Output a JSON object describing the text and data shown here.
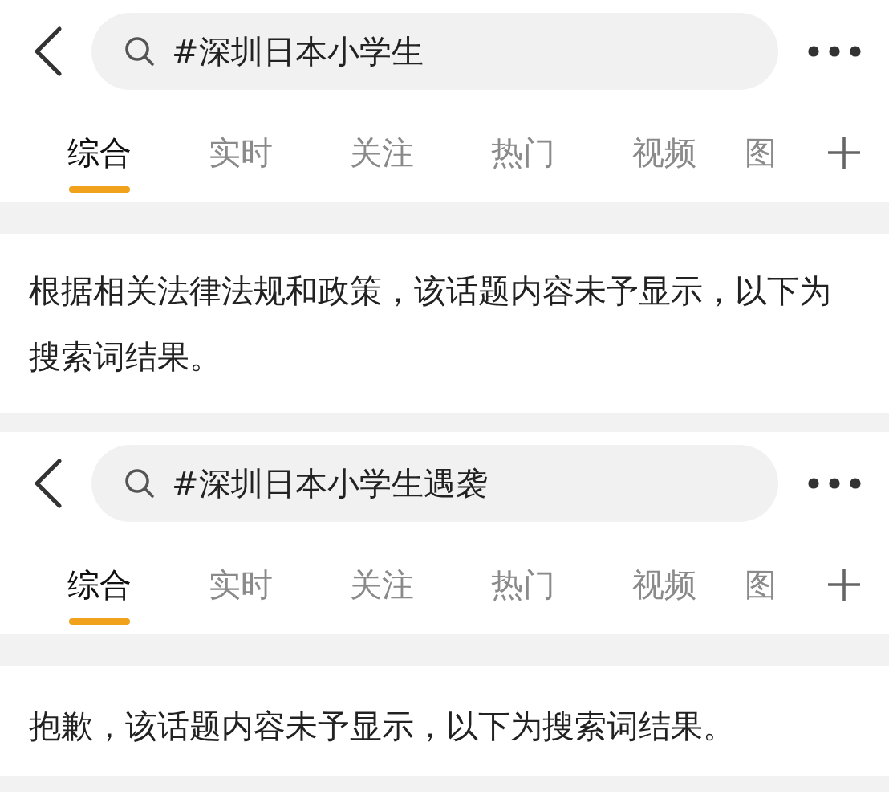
{
  "panels": [
    {
      "search": {
        "value": "#深圳日本小学生"
      },
      "tabs": [
        {
          "label": "综合",
          "selected": true
        },
        {
          "label": "实时",
          "selected": false
        },
        {
          "label": "关注",
          "selected": false
        },
        {
          "label": "热门",
          "selected": false
        },
        {
          "label": "视频",
          "selected": false
        },
        {
          "label": "图",
          "selected": false
        }
      ],
      "notice": "根据相关法律法规和政策，该话题内容未予显示，以下为搜索词结果。"
    },
    {
      "search": {
        "value": "#深圳日本小学生遇袭"
      },
      "tabs": [
        {
          "label": "综合",
          "selected": true
        },
        {
          "label": "实时",
          "selected": false
        },
        {
          "label": "关注",
          "selected": false
        },
        {
          "label": "热门",
          "selected": false
        },
        {
          "label": "视频",
          "selected": false
        },
        {
          "label": "图",
          "selected": false
        }
      ],
      "notice": "抱歉，该话题内容未予显示，以下为搜索词结果。"
    }
  ]
}
